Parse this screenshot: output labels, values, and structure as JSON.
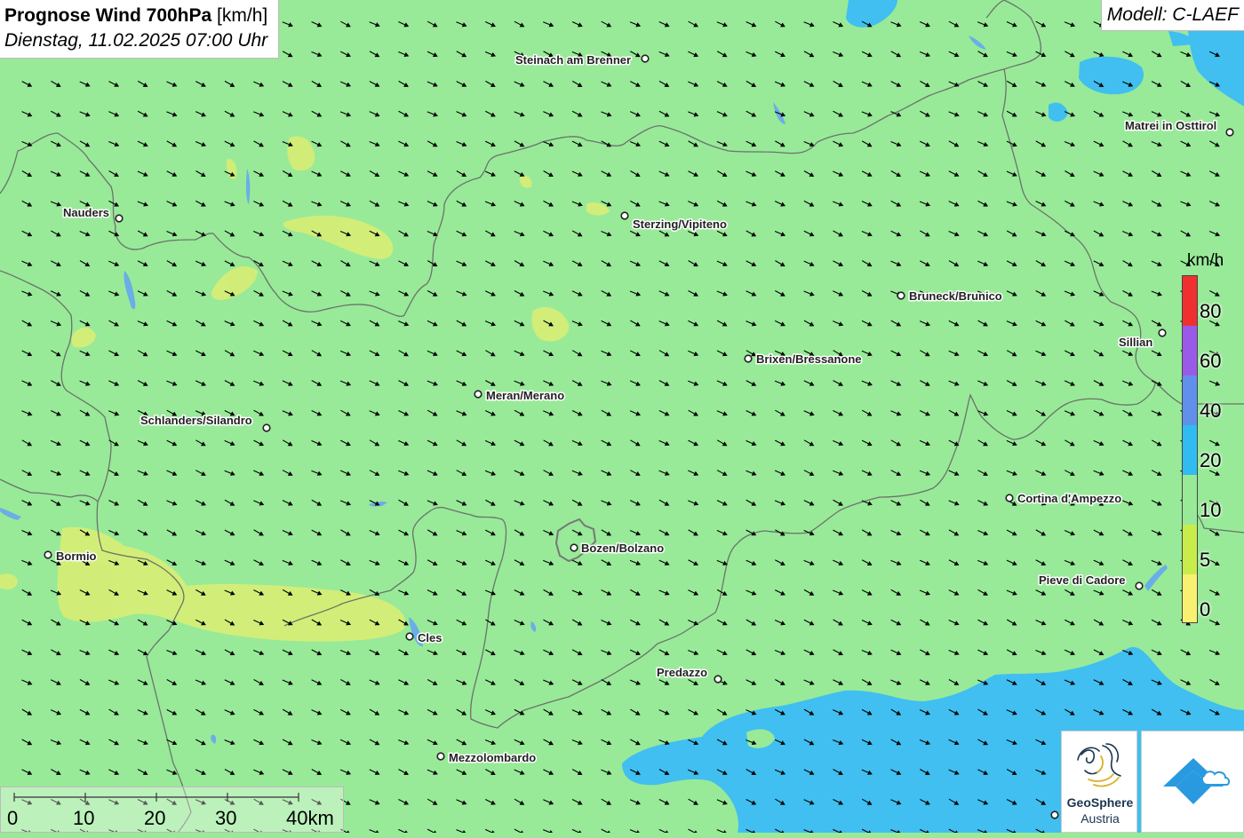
{
  "title": {
    "bold": "Prognose Wind 700hPa",
    "unit": "[km/h]",
    "datetime": "Dienstag, 11.02.2025 07:00 Uhr"
  },
  "model": "Modell: C-LAEF",
  "legend": {
    "unit": "km/h",
    "labels": [
      "80",
      "60",
      "40",
      "20",
      "10",
      "5",
      "0"
    ],
    "colors": [
      "#f03030",
      "#9a5ae8",
      "#6090ec",
      "#30bcf0",
      "#98ea98",
      "#c8ec4a",
      "#f8f070"
    ]
  },
  "scale": {
    "ticks": [
      "0",
      "10",
      "20",
      "30",
      "40km"
    ]
  },
  "cities": [
    {
      "name": "Steinach am Brenner"
    },
    {
      "name": "Matrei in Osttirol"
    },
    {
      "name": "Nauders"
    },
    {
      "name": "Sterzing/Vipiteno"
    },
    {
      "name": "Bruneck/Brunico"
    },
    {
      "name": "Sillian"
    },
    {
      "name": "Brixen/Bressanone"
    },
    {
      "name": "Meran/Merano"
    },
    {
      "name": "Schlanders/Silandro"
    },
    {
      "name": "Cortina d'Ampezzo"
    },
    {
      "name": "Bozen/Bolzano"
    },
    {
      "name": "Bormio"
    },
    {
      "name": "Pieve di Cadore"
    },
    {
      "name": "Cles"
    },
    {
      "name": "Predazzo"
    },
    {
      "name": "Mezzolombardo"
    }
  ],
  "logos": {
    "geosphere_line1": "GeoSphere",
    "geosphere_line2": "Austria"
  },
  "colors": {
    "background": "#98ea98",
    "calm": "#e0ee70",
    "strong": "#40bff0",
    "border": "#666666",
    "arrow": "#000000"
  }
}
